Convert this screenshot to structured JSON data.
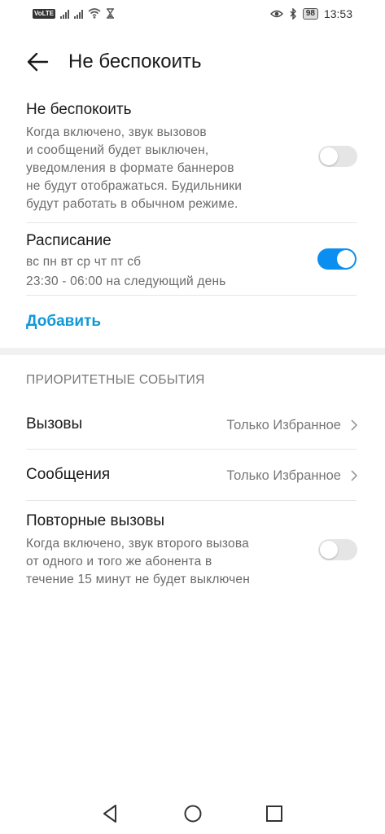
{
  "status_bar": {
    "volte": "VoLTE",
    "battery": "98",
    "time": "13:53"
  },
  "header": {
    "title": "Не беспокоить"
  },
  "dnd": {
    "title": "Не беспокоить",
    "description_lines": [
      "Когда включено, звук вызовов",
      "и сообщений будет выключен,",
      "уведомления в формате баннеров",
      "не будут отображаться. Будильники",
      "будут работать в обычном режиме."
    ],
    "enabled": false
  },
  "schedule": {
    "title": "Расписание",
    "days": "вс пн вт ср чт пт сб",
    "time_range": "23:30 - 06:00 на следующий день",
    "enabled": true
  },
  "add_label": "Добавить",
  "priority": {
    "header": "ПРИОРИТЕТНЫЕ СОБЫТИЯ",
    "calls": {
      "label": "Вызовы",
      "value": "Только Избранное"
    },
    "messages": {
      "label": "Сообщения",
      "value": "Только Избранное"
    }
  },
  "repeat_calls": {
    "title": "Повторные вызовы",
    "description_lines": [
      "Когда включено, звук второго вызова",
      "от одного и того же абонента в",
      "течение 15 минут не будет выключен"
    ],
    "enabled": false
  },
  "colors": {
    "accent": "#1098d6",
    "toggle_on": "#0a8ef0",
    "toggle_off": "#e5e5e5"
  }
}
